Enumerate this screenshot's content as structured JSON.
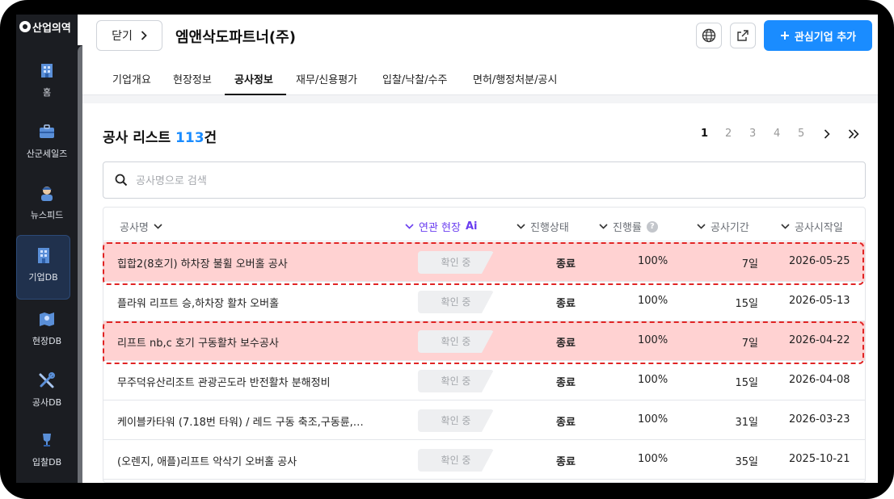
{
  "sidebar": {
    "logo_text": "산업의역",
    "items": [
      {
        "label": "홈",
        "icon": "building-icon"
      },
      {
        "label": "산군세일즈",
        "icon": "briefcase-icon"
      },
      {
        "label": "뉴스피드",
        "icon": "reporter-icon"
      },
      {
        "label": "기업DB",
        "icon": "office-icon",
        "active": true
      },
      {
        "label": "현장DB",
        "icon": "map-icon"
      },
      {
        "label": "공사DB",
        "icon": "tools-icon"
      },
      {
        "label": "입찰DB",
        "icon": "trophy-icon"
      }
    ]
  },
  "header": {
    "close_label": "닫기",
    "company_name": "엠앤삭도파트너(주)",
    "add_interest_label": "관심기업 추가"
  },
  "tabs": [
    {
      "label": "기업개요"
    },
    {
      "label": "현장정보"
    },
    {
      "label": "공사정보",
      "active": true
    },
    {
      "label": "재무/신용평가"
    },
    {
      "label": "입찰/낙찰/수주"
    },
    {
      "label": "면허/행정처분/공시"
    }
  ],
  "list": {
    "title": "공사 리스트",
    "count": "113",
    "count_suffix": "건"
  },
  "pagination": {
    "pages": [
      "1",
      "2",
      "3",
      "4",
      "5"
    ],
    "current": "1"
  },
  "search": {
    "placeholder": "공사명으로 검색"
  },
  "table": {
    "columns": {
      "name": "공사명",
      "related": "연관 현장",
      "related_ai": "Ai",
      "status": "진행상태",
      "rate": "진행률",
      "duration": "공사기간",
      "start": "공사시작일"
    },
    "rows": [
      {
        "name": "힙합2(8호기) 하차장 불휠 오버홀 공사",
        "related": "확인 중",
        "status": "종료",
        "rate": "100%",
        "duration": "7일",
        "start": "2026-05-25",
        "highlight": true
      },
      {
        "name": "플라워 리프트 승,하차장 활차 오버홀",
        "related": "확인 중",
        "status": "종료",
        "rate": "100%",
        "duration": "15일",
        "start": "2026-05-13",
        "highlight": false
      },
      {
        "name": "리프트 nb,c 호기 구동활차 보수공사",
        "related": "확인 중",
        "status": "종료",
        "rate": "100%",
        "duration": "7일",
        "start": "2026-04-22",
        "highlight": true
      },
      {
        "name": "무주덕유산리조트 관광곤도라 반전활차 분해정비",
        "related": "확인 중",
        "status": "종료",
        "rate": "100%",
        "duration": "15일",
        "start": "2026-04-08",
        "highlight": false
      },
      {
        "name": "케이블카타워 (7.18번 타워) / 레드 구동 축조,구동륜,…",
        "related": "확인 중",
        "status": "종료",
        "rate": "100%",
        "duration": "31일",
        "start": "2026-03-23",
        "highlight": false
      },
      {
        "name": "(오렌지, 애플)리프트 악삭기 오버홀 공사",
        "related": "확인 중",
        "status": "종료",
        "rate": "100%",
        "duration": "35일",
        "start": "2025-10-21",
        "highlight": false
      }
    ]
  },
  "colors": {
    "accent": "#1a8cff",
    "ai_purple": "#6a3df0",
    "highlight_fill": "#ffd2d2",
    "highlight_border": "#e02424",
    "sidebar_bg": "#1b1d22"
  }
}
